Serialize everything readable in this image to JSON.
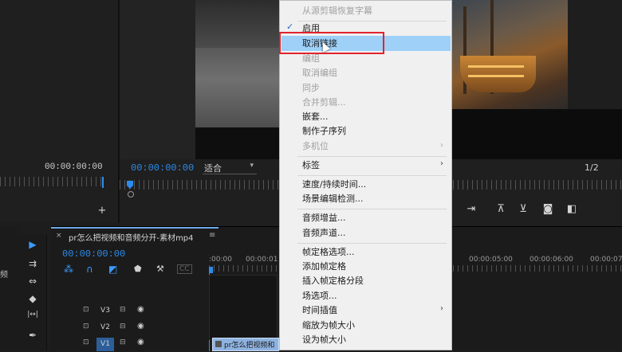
{
  "source": {
    "timecode": "00:00:00:00"
  },
  "program": {
    "timecode": "00:00:00:00",
    "fit_label": "适合",
    "ratio": "1/2"
  },
  "timeline": {
    "close_glyph": "×",
    "sequence_name": "pr怎么把视频和音频分开-素材mp4",
    "menu_glyph": "≡",
    "timecode": "00:00:00:00",
    "ruler_ticks": [
      ":00:00",
      "00:00:01",
      "00:00:05:00",
      "00:00:06:00",
      "00:00:07:00"
    ],
    "tracks": [
      "V3",
      "V2",
      "V1"
    ],
    "clip_label": "pr怎么把视频和",
    "left_panel_char": "频"
  },
  "context_menu": {
    "items": [
      {
        "label": "从源剪辑恢复字幕",
        "disabled": true
      },
      {
        "label": "启用",
        "checked": true
      },
      {
        "label": "取消链接",
        "highlighted": true
      },
      {
        "label": "编组",
        "disabled": true
      },
      {
        "label": "取消编组",
        "disabled": true
      },
      {
        "label": "同步",
        "disabled": true
      },
      {
        "label": "合并剪辑...",
        "disabled": true
      },
      {
        "label": "嵌套..."
      },
      {
        "label": "制作子序列"
      },
      {
        "label": "多机位",
        "disabled": true,
        "submenu": true
      },
      {
        "label": "标签",
        "submenu": true
      },
      {
        "label": "速度/持续时间..."
      },
      {
        "label": "场景编辑检测..."
      },
      {
        "label": "音频增益..."
      },
      {
        "label": "音频声道..."
      },
      {
        "label": "帧定格选项..."
      },
      {
        "label": "添加帧定格"
      },
      {
        "label": "插入帧定格分段"
      },
      {
        "label": "场选项..."
      },
      {
        "label": "时间插值",
        "submenu": true
      },
      {
        "label": "缩放为帧大小"
      },
      {
        "label": "设为帧大小"
      }
    ],
    "check_glyph": "✓",
    "submenu_glyph": "›"
  },
  "icons": {
    "plus": "+",
    "selection_tool": "▶",
    "track_select": "⇉",
    "ripple": "⇔",
    "razor": "◆",
    "slip": "|↔|",
    "pen": "✒",
    "lock": "🔒",
    "eye": "👁",
    "export_frame": "📷"
  },
  "colors": {
    "accent": "#2d8ceb",
    "highlight": "#9ed0f8",
    "annotation": "#e0232e"
  }
}
